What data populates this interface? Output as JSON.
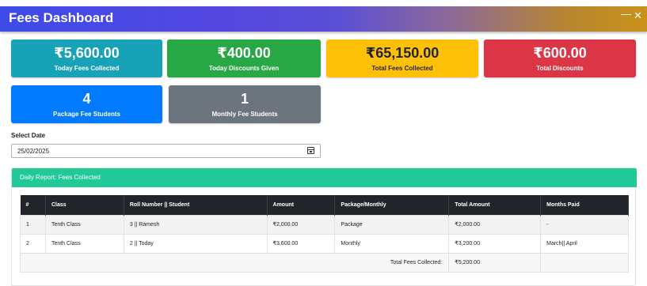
{
  "app": {
    "title": "Fees Dashboard",
    "minimize": "—",
    "close": "✕"
  },
  "cards": [
    {
      "value": "₹5,600.00",
      "label": "Today Fees Collected",
      "color": "#17a2b8"
    },
    {
      "value": "₹400.00",
      "label": "Today Discounts Given",
      "color": "#28a745"
    },
    {
      "value": "₹65,150.00",
      "label": "Total Fees Collected",
      "color": "#ffc107"
    },
    {
      "value": "₹600.00",
      "label": "Total Discounts",
      "color": "#dc3545"
    },
    {
      "value": "4",
      "label": "Package Fee Students",
      "color": "#007bff"
    },
    {
      "value": "1",
      "label": "Monthly Fee Students",
      "color": "#6c757d"
    }
  ],
  "date_filter": {
    "label": "Select Date",
    "value": "25/02/2025",
    "icon": "calendar-icon"
  },
  "report": {
    "title": "Daily Report: Fees Collected",
    "columns": [
      "#",
      "Class",
      "Roll Number || Student",
      "Amount",
      "Package/Monthly",
      "Total Amount",
      "Months Paid"
    ],
    "rows": [
      [
        "1",
        "Tenth Class",
        "3 || Ramesh",
        "₹2,000.00",
        "Package",
        "₹2,000.00",
        "-"
      ],
      [
        "2",
        "Tenth Class",
        "2 || Today",
        "₹3,600.00",
        "Monthly",
        "₹3,200.00",
        "March|| April"
      ]
    ],
    "total_label": "Total Fees Collected:",
    "total_value": "₹5,200.00"
  }
}
